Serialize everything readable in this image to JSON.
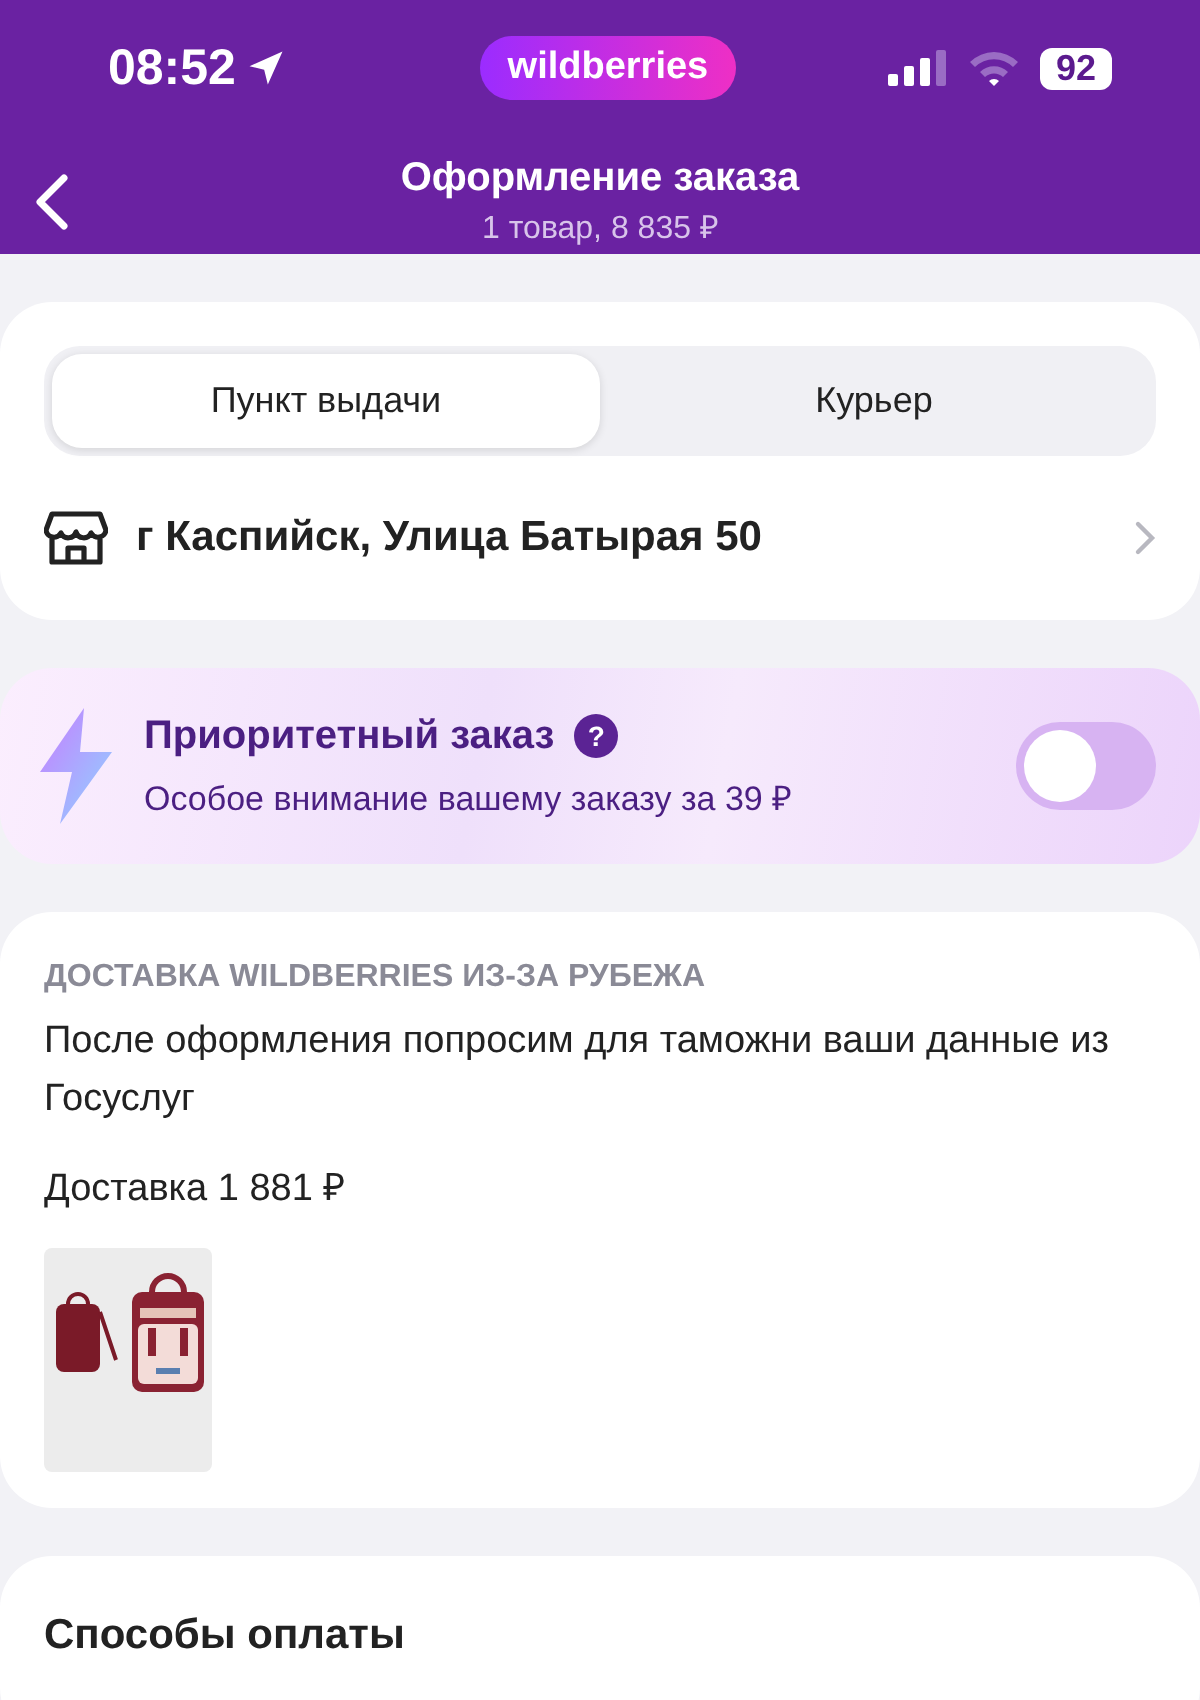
{
  "status_bar": {
    "time": "08:52",
    "brand": "wildberries",
    "battery": "92"
  },
  "header": {
    "title": "Оформление заказа",
    "subtitle": "1 товар, 8 835 ₽"
  },
  "delivery_tabs": [
    {
      "label": "Пункт выдачи",
      "selected": true
    },
    {
      "label": "Курьер",
      "selected": false
    }
  ],
  "address": "г Каспийск, Улица Батырая 50",
  "priority": {
    "title": "Приоритетный заказ",
    "help": "?",
    "subtitle": "Особое внимание вашему заказу за 39 ₽",
    "on": false
  },
  "shipment": {
    "heading": "ДОСТАВКА WILDBERRIES ИЗ-ЗА РУБЕЖА",
    "note": "После оформления попросим для таможни ваши данные из Госуслуг",
    "cost": "Доставка 1 881 ₽"
  },
  "payment": {
    "heading": "Способы оплаты"
  }
}
